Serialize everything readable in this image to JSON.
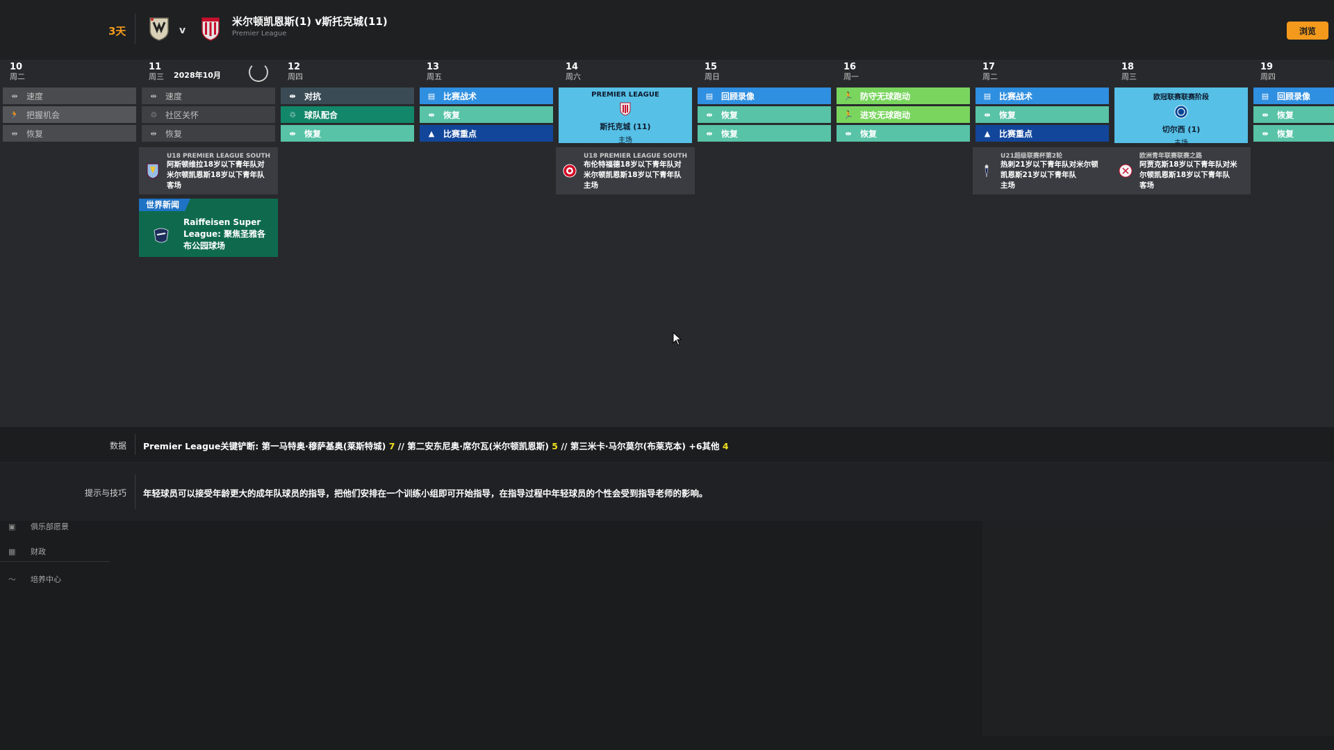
{
  "header": {
    "days_left": "3天",
    "vs": "v",
    "match_title": "米尔顿凯恩斯(1) v斯托克城(11)",
    "competition": "Premier League",
    "browse_button": "浏览"
  },
  "calendar": {
    "month_label": "2028年10月",
    "days": [
      {
        "num": "10",
        "weekday": "周二",
        "slots": [
          {
            "label": "速度",
            "icon": "recovery-arrows"
          },
          {
            "label": "把握机会",
            "icon": "runner"
          },
          {
            "label": "恢复",
            "icon": "recovery-arrows"
          }
        ]
      },
      {
        "num": "11",
        "weekday": "周三",
        "slots": [
          {
            "label": "速度",
            "icon": "recovery-arrows"
          },
          {
            "label": "社区关怀",
            "icon": "community"
          },
          {
            "label": "恢复",
            "icon": "recovery-arrows"
          }
        ]
      },
      {
        "num": "12",
        "weekday": "周四",
        "slots": [
          {
            "label": "对抗",
            "icon": "recovery-arrows"
          },
          {
            "label": "球队配合",
            "icon": "teamwork"
          },
          {
            "label": "恢复",
            "icon": "recovery-arrows"
          }
        ]
      },
      {
        "num": "13",
        "weekday": "周五",
        "slots": [
          {
            "label": "比赛战术",
            "icon": "tactics-board"
          },
          {
            "label": "恢复",
            "icon": "recovery-arrows"
          },
          {
            "label": "比赛重点",
            "icon": "cone"
          }
        ]
      },
      {
        "num": "14",
        "weekday": "周六",
        "match": {
          "competition": "PREMIER LEAGUE",
          "opponent": "斯托克城 (11)",
          "venue": "主场"
        }
      },
      {
        "num": "15",
        "weekday": "周日",
        "slots": [
          {
            "label": "回顾录像",
            "icon": "tactics-board"
          },
          {
            "label": "恢复",
            "icon": "recovery-arrows"
          },
          {
            "label": "恢复",
            "icon": "recovery-arrows"
          }
        ]
      },
      {
        "num": "16",
        "weekday": "周一",
        "slots": [
          {
            "label": "防守无球跑动",
            "icon": "runner"
          },
          {
            "label": "进攻无球跑动",
            "icon": "runner"
          },
          {
            "label": "恢复",
            "icon": "recovery-arrows"
          }
        ]
      },
      {
        "num": "17",
        "weekday": "周二",
        "slots": [
          {
            "label": "比赛战术",
            "icon": "tactics-board"
          },
          {
            "label": "恢复",
            "icon": "recovery-arrows"
          },
          {
            "label": "比赛重点",
            "icon": "cone"
          }
        ]
      },
      {
        "num": "18",
        "weekday": "周三",
        "match": {
          "competition": "欧冠联赛联赛阶段",
          "opponent": "切尔西 (1)",
          "venue": "主场"
        }
      },
      {
        "num": "19",
        "weekday": "周四",
        "slots": [
          {
            "label": "回顾录像",
            "icon": "tactics-board"
          },
          {
            "label": "恢复",
            "icon": "recovery-arrows"
          },
          {
            "label": "恢复",
            "icon": "recovery-arrows"
          }
        ]
      }
    ],
    "events": [
      {
        "caption": "U18 PREMIER LEAGUE SOUTH",
        "text": "阿斯顿维拉18岁以下青年队对米尔顿凯恩斯18岁以下青年队",
        "venue": "客场"
      },
      {
        "caption": "U18 PREMIER LEAGUE SOUTH",
        "text": "布伦特福德18岁以下青年队对米尔顿凯恩斯18岁以下青年队",
        "venue": "主场"
      },
      {
        "caption": "U21超级联赛杯第2轮",
        "text": "热刺21岁以下青年队对米尔顿凯恩斯21岁以下青年队",
        "venue": "主场"
      },
      {
        "caption": "欧洲青年联赛联赛之路",
        "text": "阿贾克斯18岁以下青年队对米尔顿凯恩斯18岁以下青年队",
        "venue": "客场"
      }
    ],
    "news": {
      "tag": "世界新闻",
      "text": "Raiffeisen Super League: 聚焦圣雅各布公园球场"
    }
  },
  "stats": {
    "label": "数据",
    "prefix": "Premier League关键铲断: 第一马特奥·穆萨基奥(莱斯特城)",
    "v1": "7",
    "mid1": "// 第二安东尼奥·席尔瓦(米尔顿凯恩斯)",
    "v2": "5",
    "mid2": "// 第三米卡·马尔莫尔(布莱克本) +6其他",
    "v3": "4"
  },
  "tips": {
    "label": "提示与技巧",
    "text": "年轻球员可以接受年龄更大的成年队球员的指导，把他们安排在一个训练小组即可开始指导，在指导过程中年轻球员的个性会受到指导老师的影响。"
  },
  "nav": [
    {
      "label": "俱乐部愿景",
      "icon": "vision-icon"
    },
    {
      "label": "财政",
      "icon": "finance-icon"
    },
    {
      "label": "培养中心",
      "icon": "development-icon"
    }
  ],
  "colors": {
    "accent": "#f39a1d",
    "match_day": "#56c0e6",
    "news_bg": "#0f6a4d",
    "stat_highlight": "#f0e020"
  }
}
